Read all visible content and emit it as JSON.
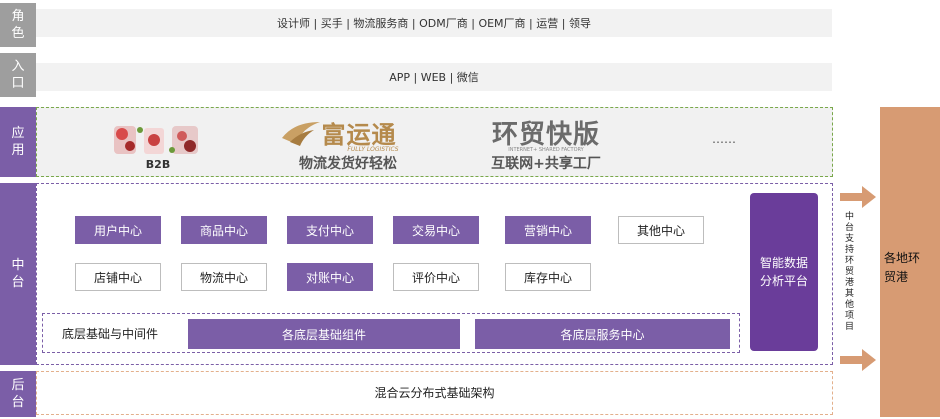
{
  "layers": {
    "role": "角色",
    "entry": "入口",
    "app": "应用",
    "middle": "中台",
    "back": "后台"
  },
  "role_bar": "设计师 | 买手 | 物流服务商 | ODM厂商 | OEM厂商 | 运营 | 领导",
  "entry_bar": "APP | WEB | 微信",
  "apps": {
    "b2b": "B2B",
    "fuyuntong_title": "富运通",
    "fuyuntong_en": "FULLY LOGISTICS",
    "fuyuntong_slogan": "物流发货好轻松",
    "huanmao_title": "环贸快版",
    "huanmao_en": "INTERNET+ SHARED FACTORY",
    "huanmao_slogan": "互联网+共享工厂",
    "more": "……"
  },
  "modules_row1": [
    "用户中心",
    "商品中心",
    "支付中心",
    "交易中心",
    "营销中心",
    "其他中心"
  ],
  "modules_row2": [
    "店铺中心",
    "物流中心",
    "对账中心",
    "评价中心",
    "库存中心"
  ],
  "base_label": "底层基础与中间件",
  "base_components": "各底层基础组件",
  "base_services": "各底层服务中心",
  "smart_platform": "智能数据分析平台",
  "side_note": "中台支持环贸港其他项目",
  "right_block": "各地环贸港",
  "backend_bar": "混合云分布式基础架构",
  "colors": {
    "purple": "#7b5ea7",
    "dark_purple": "#6a3d9a",
    "orange": "#d79b73",
    "green_dash": "#79a84a",
    "orange_dash": "#e3b08c"
  }
}
